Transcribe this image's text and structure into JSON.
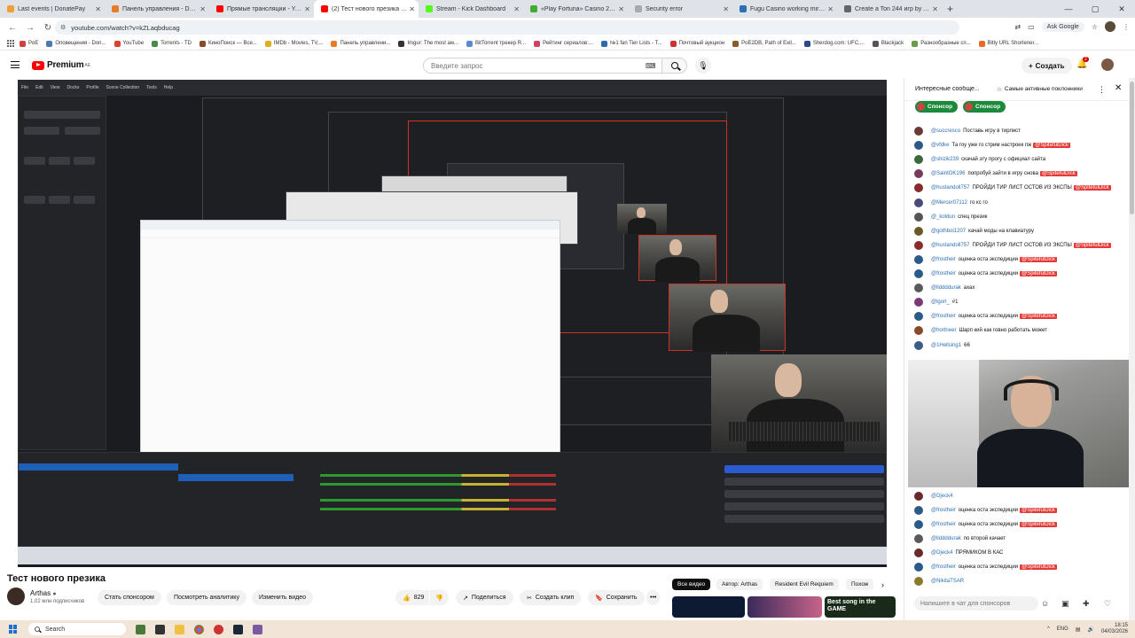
{
  "browser": {
    "tabs": [
      {
        "title": "Last events | DonatePay",
        "color": "#f0a030",
        "active": false
      },
      {
        "title": "Панель управления - Donatio",
        "color": "#e87a2a",
        "active": false
      },
      {
        "title": "Прямые трансляции - YouTub",
        "color": "#ff0000",
        "active": false
      },
      {
        "title": "(2) Тест нового презика - You",
        "color": "#ff0000",
        "active": true
      },
      {
        "title": "Stream - Kick Dashboard",
        "color": "#53fc18",
        "active": false
      },
      {
        "title": "«Play Fortuna» Casino 2026 | R",
        "color": "#4a3",
        "active": false
      },
      {
        "title": "Security error",
        "color": "#aaa",
        "active": false
      },
      {
        "title": "Fugu Casino working mirror for",
        "color": "#2b6fb5",
        "active": false
      },
      {
        "title": "Create a Ton 244 игр by Arthas",
        "color": "#666",
        "active": false
      }
    ],
    "url": "youtube.com/watch?v=kZLaqbducag",
    "ask_google": "Ask Google",
    "bookmarks": [
      "PoE",
      "Оповещения - Don...",
      "YouTube",
      "Torrents - TD",
      "КиноПоиск — Все...",
      "IMDb - Movies, TV,...",
      "Панель управлени...",
      "Imgur: The most aw...",
      "BitTorrent трекер R...",
      "Рейтинг сериалов:...",
      "№1 fan Tier Lists - T...",
      "Почтовый аукцион",
      "PoE2DB, Path of Exil...",
      "Sherdog.com: UFC,...",
      "Blackjack",
      "Разнообразные сп...",
      "Bitly URL Shortener..."
    ]
  },
  "youtube": {
    "logo": "Premium",
    "logo_region": "AE",
    "search_placeholder": "Введите запрос",
    "create_label": "Создать",
    "notif_count": "2"
  },
  "video": {
    "title": "Тест нового презика",
    "channel": "Arthas",
    "subscribers": "1,02 млн подписчиков",
    "actions": {
      "sponsor": "Стать спонсором",
      "analytics": "Посмотреть аналитику",
      "edit": "Изменить видео",
      "likes": "829",
      "share": "Поделиться",
      "clip": "Создать клип",
      "save": "Сохранить"
    },
    "chips": [
      "Все видео",
      "Автор: Arthas",
      "Resident Evil Requiem",
      "Похож"
    ],
    "thumb_text": "Best song in the GAME"
  },
  "chat": {
    "header_title": "Интересные сообще...",
    "header_sub": "Самые активные поклонники",
    "sponsors": [
      "Спонсор",
      "Спонсор"
    ],
    "messages": [
      {
        "author": "@succresco",
        "text": "Поставь игру в тирлист",
        "tag": "",
        "avatar": "#6a3a3a"
      },
      {
        "author": "@vfdke",
        "text": "Та гоу уже го стрим настроек пж",
        "tag": "@SpitefulDick",
        "avatar": "#2a5a8a"
      },
      {
        "author": "@shizik239",
        "text": "скачай эту прогу с официал сайта",
        "tag": "",
        "avatar": "#3a6a3a"
      },
      {
        "author": "@SaintOK196",
        "text": "попробуй зайти в игру снова",
        "tag": "@SpitefulDick",
        "avatar": "#7a3a5a"
      },
      {
        "author": "@hustandoll757",
        "text": "ПРОЙДИ ТИР ЛИСТ ОСТОВ ИЗ ЭКСПЫ",
        "tag": "@SpitefulDick",
        "avatar": "#8a2a2a"
      },
      {
        "author": "@Mercer07112",
        "text": "го кс го",
        "tag": "",
        "avatar": "#4a4a7a"
      },
      {
        "author": "@_koldun",
        "text": "спец презик",
        "tag": "",
        "avatar": "#555"
      },
      {
        "author": "@gothboi1207",
        "text": "качай моды на клавиатуру",
        "tag": "",
        "avatar": "#6a5a2a"
      },
      {
        "author": "@hustandoll757",
        "text": "ПРОЙДИ ТИР ЛИСТ ОСТОВ ИЗ ЭКСПЫ",
        "tag": "@SpitefulDick",
        "avatar": "#8a2a2a"
      },
      {
        "author": "@frostheir",
        "text": "оценка оста экспедиции",
        "tag": "@SpitefulDick",
        "avatar": "#2a5a8a"
      },
      {
        "author": "@frostheir",
        "text": "оценка оста экспедиции",
        "tag": "@SpitefulDick",
        "avatar": "#2a5a8a"
      },
      {
        "author": "@llddddurak",
        "text": "ахах",
        "tag": "",
        "avatar": "#5a5a5a"
      },
      {
        "author": "@lgorl_",
        "text": "#1",
        "tag": "",
        "avatar": "#7a3a7a"
      },
      {
        "author": "@frostheir",
        "text": "оценка оста экспедиции",
        "tag": "@SpitefulDick",
        "avatar": "#2a5a8a"
      },
      {
        "author": "@hortneer",
        "text": "Шарп кий как говно работать может",
        "tag": "",
        "avatar": "#8a4a2a"
      },
      {
        "author": "@1Hellsing1",
        "text": "66",
        "tag": "",
        "avatar": "#3a5a8a"
      }
    ],
    "messages_bottom": [
      {
        "author": "@Djeck4",
        "text": "",
        "tag": "",
        "avatar": "#6a2a2a"
      },
      {
        "author": "@frostheir",
        "text": "оценка оста экспедиции",
        "tag": "@SpitefulDick",
        "avatar": "#2a5a8a"
      },
      {
        "author": "@frostheir",
        "text": "оценка оста экспедиции",
        "tag": "@SpitefulDick",
        "avatar": "#2a5a8a"
      },
      {
        "author": "@llddddurak",
        "text": "по второй качает",
        "tag": "",
        "avatar": "#5a5a5a"
      },
      {
        "author": "@Djeck4",
        "text": "ПРЯМИКОМ В КАС",
        "tag": "",
        "avatar": "#6a2a2a"
      },
      {
        "author": "@frostheir",
        "text": "оценка оста экспедиции",
        "tag": "@SpitefulDick",
        "avatar": "#2a5a8a"
      },
      {
        "author": "@NikitaTSAR",
        "text": "",
        "tag": "",
        "avatar": "#8a7a2a"
      }
    ],
    "input_placeholder": "Напишите в чат для спонсоров"
  },
  "taskbar": {
    "search": "Search",
    "lang": "ENG",
    "time": "18:15",
    "date": "04/03/2026"
  }
}
